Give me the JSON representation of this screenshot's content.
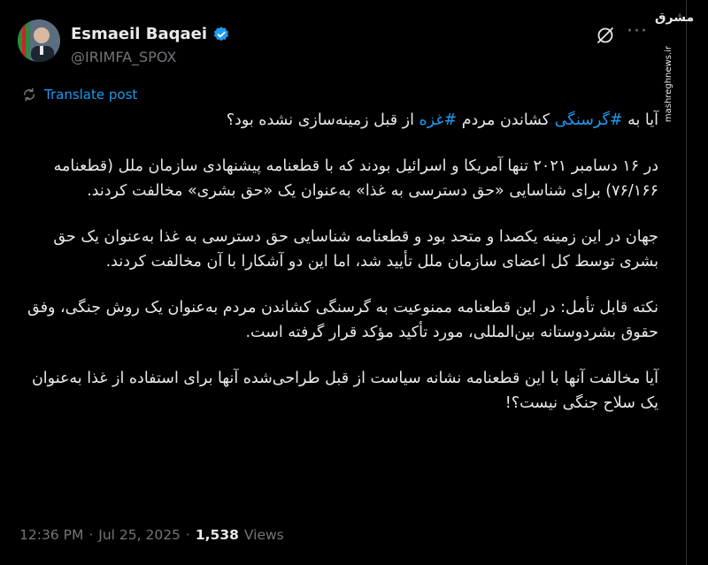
{
  "author": {
    "name": "Esmaeil Baqaei",
    "handle": "@IRIMFA_SPOX"
  },
  "translate_label": "Translate post",
  "tweet": {
    "p1": {
      "a": "آیا به ",
      "tag1": "#گرسنگی",
      "b": " کشاندن مردم ",
      "tag2": "#غزه",
      "c": " از قبل زمینه‌سازی نشده بود؟"
    },
    "p2": "در ۱۶ دسامبر ۲۰۲۱ تنها آمریکا و اسرائیل بودند که با قطعنامه پیشنهادی سازمان ملل (قطعنامه ۷۶/۱۶۶) برای شناسایی «حق دسترسی به غذا» به‌عنوان یک «حق بشری» مخالفت کردند.",
    "p3": "جهان در این زمینه یکصدا و متحد بود و قطعنامه شناسایی حق دسترسی به غذا به‌عنوان یک حق بشری توسط کل اعضای سازمان ملل تأیید شد، اما این دو آشکارا با آن مخالفت کردند.",
    "p4": "نکته قابل تأمل: در این قطعنامه ممنوعیت به گرسنگی کشاندن مردم به‌عنوان یک روش جنگی، وفق حقوق بشردوستانه بین‌المللی، مورد تأکید مؤکد قرار گرفته است.",
    "p5": "آیا مخالفت آنها با این قطعنامه نشانه سیاست از قبل طراحی‌شده آنها برای استفاده از غذا به‌عنوان یک سلاح جنگی نیست؟!"
  },
  "meta": {
    "time": "12:36 PM",
    "sep1": "·",
    "date": "Jul 25, 2025",
    "sep2": "·",
    "views_count": "1,538",
    "views_label": "Views"
  },
  "watermark": {
    "logo": "مشرق",
    "site": "mashreghnews.ir"
  },
  "colors": {
    "background": "#000000",
    "text": "#e7e9ea",
    "secondary": "#71767b",
    "accent": "#1d9bf0"
  },
  "icons": [
    "verified-badge-icon",
    "grok-icon",
    "more-icon",
    "translate-icon"
  ]
}
